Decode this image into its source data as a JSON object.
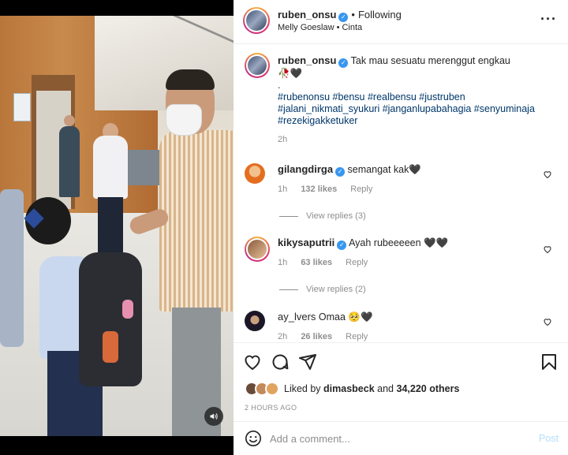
{
  "header": {
    "username": "ruben_onsu",
    "follow_status": "Following",
    "location_line": "Melly Goeslaw • Cinta",
    "more_icon": "more-horizontal-icon"
  },
  "caption": {
    "username": "ruben_onsu",
    "text": "Tak mau sesuatu merenggut engkau",
    "emoji_line": "🥀🖤",
    "dot": ".",
    "hashtags": "#rubenonsu #bensu #realbensu #justruben #jalani_nikmati_syukuri #janganlupabahagia #senyuminaja #rezekigakketuker",
    "time": "2h"
  },
  "comments": [
    {
      "username": "gilangdirga",
      "verified": true,
      "text": "semangat kak🖤",
      "time": "1h",
      "likes": "132 likes",
      "reply_label": "Reply",
      "view_replies": "View replies (3)"
    },
    {
      "username": "kikysaputrii",
      "verified": true,
      "text": "Ayah rubeeeeen 🖤🖤",
      "time": "1h",
      "likes": "63 likes",
      "reply_label": "Reply",
      "view_replies": "View replies (2)"
    },
    {
      "username": "ay_lvers",
      "verified": false,
      "text": "Omaa 🥺🖤",
      "time": "2h",
      "likes": "26 likes",
      "reply_label": "Reply"
    }
  ],
  "actions": {
    "like_icon": "heart-icon",
    "comment_icon": "comment-icon",
    "share_icon": "share-icon",
    "save_icon": "bookmark-icon"
  },
  "likes": {
    "prefix": "Liked by",
    "user": "dimasbeck",
    "and": "and",
    "others": "34,220 others"
  },
  "post_time": "2 HOURS AGO",
  "add_comment": {
    "placeholder": "Add a comment...",
    "post_label": "Post"
  },
  "colors": {
    "link": "#00376b",
    "verified": "#3897f0",
    "muted": "#8e8e8e",
    "post_disabled": "#b2dffc"
  }
}
